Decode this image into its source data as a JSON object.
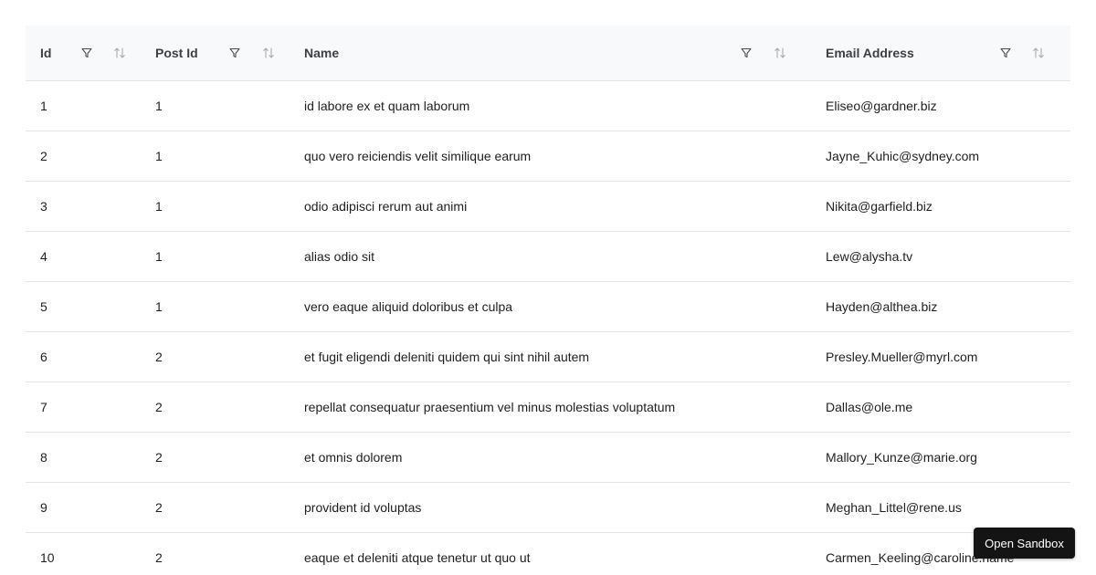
{
  "table": {
    "columns": [
      {
        "key": "id",
        "label": "Id",
        "filter_icon": "filter-icon",
        "sort_icon": "sort-arrows-icon"
      },
      {
        "key": "postId",
        "label": "Post Id",
        "filter_icon": "filter-icon",
        "sort_icon": "sort-arrows-icon"
      },
      {
        "key": "name",
        "label": "Name",
        "filter_icon": "filter-icon",
        "sort_icon": "sort-arrows-icon"
      },
      {
        "key": "email",
        "label": "Email Address",
        "filter_icon": "filter-icon",
        "sort_icon": "sort-arrows-icon"
      }
    ],
    "rows": [
      {
        "id": "1",
        "postId": "1",
        "name": "id labore ex et quam laborum",
        "email": "Eliseo@gardner.biz"
      },
      {
        "id": "2",
        "postId": "1",
        "name": "quo vero reiciendis velit similique earum",
        "email": "Jayne_Kuhic@sydney.com"
      },
      {
        "id": "3",
        "postId": "1",
        "name": "odio adipisci rerum aut animi",
        "email": "Nikita@garfield.biz"
      },
      {
        "id": "4",
        "postId": "1",
        "name": "alias odio sit",
        "email": "Lew@alysha.tv"
      },
      {
        "id": "5",
        "postId": "1",
        "name": "vero eaque aliquid doloribus et culpa",
        "email": "Hayden@althea.biz"
      },
      {
        "id": "6",
        "postId": "2",
        "name": "et fugit eligendi deleniti quidem qui sint nihil autem",
        "email": "Presley.Mueller@myrl.com"
      },
      {
        "id": "7",
        "postId": "2",
        "name": "repellat consequatur praesentium vel minus molestias voluptatum",
        "email": "Dallas@ole.me"
      },
      {
        "id": "8",
        "postId": "2",
        "name": "et omnis dolorem",
        "email": "Mallory_Kunze@marie.org"
      },
      {
        "id": "9",
        "postId": "2",
        "name": "provident id voluptas",
        "email": "Meghan_Littel@rene.us"
      },
      {
        "id": "10",
        "postId": "2",
        "name": "eaque et deleniti atque tenetur ut quo ut",
        "email": "Carmen_Keeling@caroline.name"
      }
    ]
  },
  "sandbox_button": {
    "label": "Open Sandbox"
  },
  "colors": {
    "header_bg": "#f8f9fa",
    "border": "#e3e5e8",
    "button_bg": "#141414"
  }
}
